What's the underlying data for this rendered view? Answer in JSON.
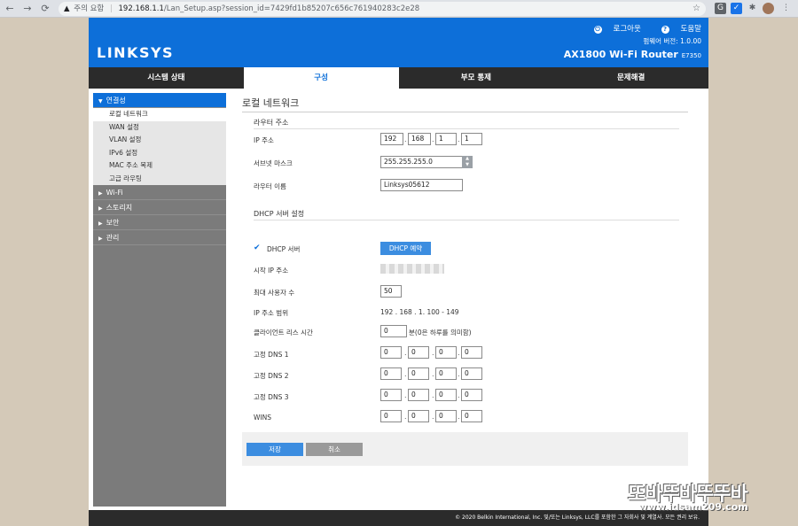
{
  "browser": {
    "warning": "주의 요함",
    "host": "192.168.1.1",
    "path": "/Lan_Setup.asp?session_id=7429fd1b85207c656c761940283c2e28"
  },
  "header": {
    "brand": "LINKSYS",
    "logout": "로그아웃",
    "help": "도움말",
    "firmware_label": "펌웨어 버전:",
    "firmware_value": "1.0.00",
    "model": "AX1800 Wi-Fi Router",
    "model_code": "E7350"
  },
  "nav": {
    "tabs": [
      "시스템 상태",
      "구성",
      "부모 통제",
      "문제해결"
    ],
    "active_index": 1
  },
  "sidebar": {
    "sections": [
      {
        "label": "연결성",
        "expanded": true
      },
      {
        "label": "Wi-Fi"
      },
      {
        "label": "스토리지"
      },
      {
        "label": "보안"
      },
      {
        "label": "관리"
      }
    ],
    "subitems": [
      "로컬 네트워크",
      "WAN 설정",
      "VLAN 설정",
      "IPv6 설정",
      "MAC 주소 복제",
      "고급 라우팅"
    ]
  },
  "main": {
    "page_title": "로컬 네트워크",
    "router_section": "라우터 주소",
    "ip_label": "IP 주소",
    "ip": [
      "192",
      "168",
      "1",
      "1"
    ],
    "subnet_label": "서브넷 마스크",
    "subnet_value": "255.255.255.0",
    "router_name_label": "라우터 이름",
    "router_name": "Linksys05612",
    "dhcp_section": "DHCP 서버 설정",
    "dhcp_server_label": "DHCP 서버",
    "dhcp_reserve_button": "DHCP 예약",
    "start_ip_label": "시작 IP 주소",
    "max_users_label": "최대 사용자 수",
    "max_users": "50",
    "ip_range_label": "IP 주소 범위",
    "ip_range_value": "192 . 168 . 1. 100 - 149",
    "lease_label": "클라이언트 리스 시간",
    "lease_value": "0",
    "lease_note": "분(0은 하루를 의미함)",
    "dns1_label": "고정 DNS 1",
    "dns2_label": "고정 DNS 2",
    "dns3_label": "고정 DNS 3",
    "wins_label": "WINS",
    "zero": "0",
    "save_button": "저장",
    "cancel_button": "취소"
  },
  "footer": {
    "copyright": "© 2020 Belkin International, Inc. 및/또는 Linksys, LLC를 포함한 그 자회사 및 계열사. 모든 권리 보유."
  },
  "watermark": {
    "text": "또바뚜바뚜뚜바",
    "url": "www.idsam209.com"
  },
  "colors": {
    "brand_blue": "#0d6fd9",
    "nav_dark": "#2b2b2b",
    "button_blue": "#3c8de0"
  }
}
